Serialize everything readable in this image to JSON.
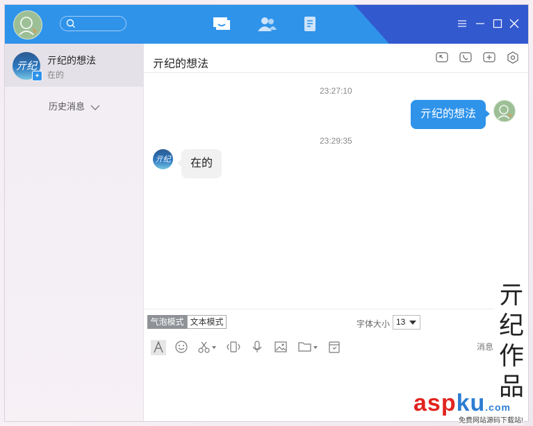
{
  "titlebar": {
    "search_placeholder": "",
    "nav": [
      "chat-icon",
      "contacts-icon",
      "notes-icon"
    ],
    "window_controls": [
      "menu-icon",
      "minimize-icon",
      "maximize-icon",
      "close-icon"
    ]
  },
  "sidebar": {
    "contact_name": "亓纪的想法",
    "contact_status": "在的",
    "contact_avatar_text": "亓纪",
    "history_label": "历史消息"
  },
  "chat": {
    "title": "亓纪的想法",
    "header_icons": [
      "remote-assist-icon",
      "call-icon",
      "add-member-icon",
      "settings-icon"
    ],
    "messages": [
      {
        "time": "23:27:10",
        "direction": "out",
        "text": "亓纪的想法"
      },
      {
        "time": "23:29:35",
        "direction": "in",
        "text": "在的",
        "avatar_text": "亓纪"
      }
    ]
  },
  "composer": {
    "mode_bubble": "气泡模式",
    "mode_text": "文本模式",
    "font_size_label": "字体大小",
    "font_size_value": "13",
    "tools": [
      "font-icon",
      "emoji-icon",
      "screenshot-icon",
      "shake-icon",
      "voice-icon",
      "image-icon",
      "folder-icon",
      "history-icon"
    ],
    "message_hint": "消息"
  },
  "overlay": {
    "watermark_chars": [
      "亓",
      "纪",
      "作",
      "品"
    ],
    "site_logo_a": "asp",
    "site_logo_b": "ku",
    "site_logo_c": ".com",
    "site_subtitle": "免费网站源码下载站!"
  },
  "colors": {
    "accent": "#2f93ea",
    "titlebar_dark": "#3359cf",
    "bubble_in": "#f1f1f2"
  }
}
